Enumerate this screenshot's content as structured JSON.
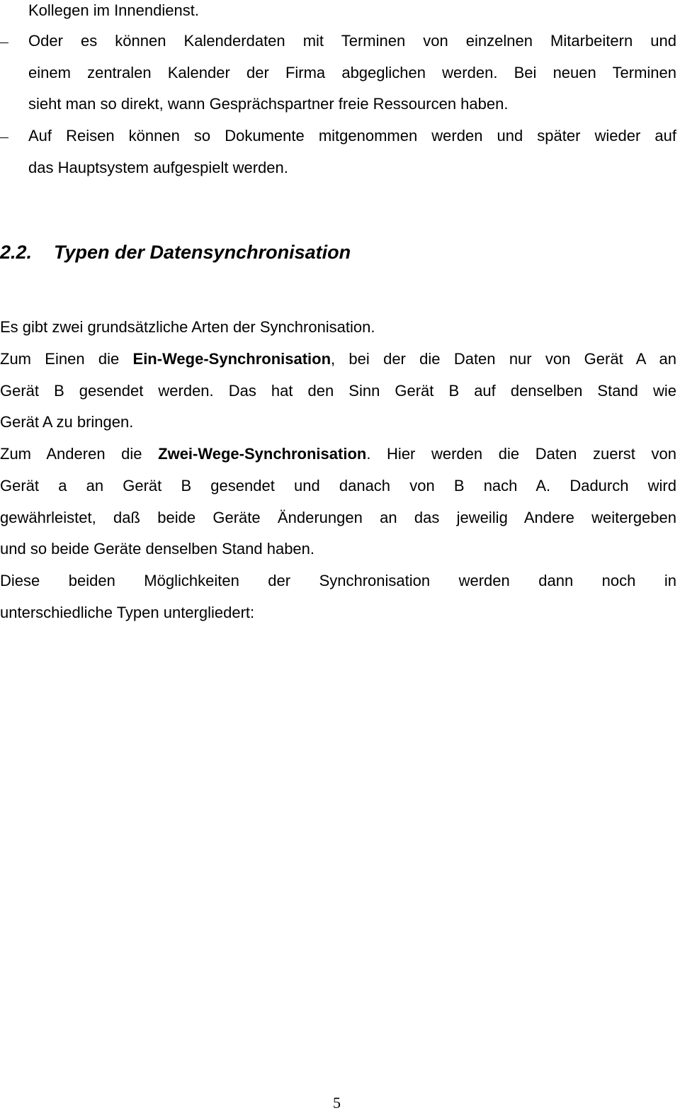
{
  "bullets": {
    "continuation": "Kollegen im Innendienst.",
    "items": [
      {
        "lines": [
          "Oder es können Kalenderdaten mit Terminen von einzelnen Mitarbeitern und",
          "einem zentralen Kalender der Firma abgeglichen werden. Bei neuen Terminen",
          "sieht man so direkt, wann Gesprächspartner freie Ressourcen haben."
        ]
      },
      {
        "lines": [
          "Auf Reisen können so Dokumente mitgenommen werden und später wieder auf",
          "das Hauptsystem aufgespielt werden."
        ]
      }
    ]
  },
  "section": {
    "number": "2.2.",
    "title": "Typen der Datensynchronisation"
  },
  "body": {
    "intro": "Es gibt zwei grundsätzliche Arten der Synchronisation.",
    "one_way": {
      "prefix": "Zum Einen die ",
      "term": "Ein-Wege-Synchronisation",
      "suffix": ", bei der die Daten nur von Gerät A an",
      "line2": "Gerät B gesendet werden. Das hat den Sinn Gerät B auf denselben Stand wie",
      "line3": "Gerät A zu bringen."
    },
    "two_way": {
      "prefix": "Zum Anderen die ",
      "term": "Zwei-Wege-Synchronisation",
      "suffix": ". Hier werden die Daten zuerst von",
      "line2": "Gerät a an Gerät B gesendet und danach von B nach A. Dadurch wird",
      "line3": "gewährleistet, daß beide Geräte Änderungen an das jeweilig Andere weitergeben",
      "line4": "und so beide Geräte denselben Stand haben."
    },
    "closing": {
      "line1": "Diese beiden Möglichkeiten der Synchronisation werden dann noch in",
      "line2": "unterschiedliche Typen untergliedert:"
    }
  },
  "footer": {
    "page_number": "5"
  }
}
